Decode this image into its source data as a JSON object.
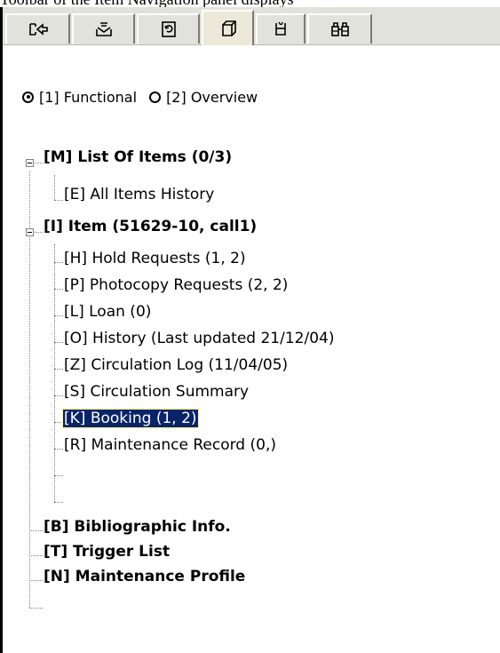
{
  "caption": "Toolbar of the Item Navigation panel displays",
  "toolbar": {
    "tabs": [
      {
        "icon": "pointer-arrow-icon",
        "active": false
      },
      {
        "icon": "inbox-tray-icon",
        "active": false
      },
      {
        "icon": "refresh-document-icon",
        "active": false
      },
      {
        "icon": "copy-window-icon",
        "active": true
      },
      {
        "icon": "broken-cup-icon",
        "active": false
      },
      {
        "icon": "binoculars-icon",
        "active": false
      }
    ]
  },
  "view_mode": {
    "options": [
      {
        "label": "[1] Functional",
        "checked": true
      },
      {
        "label": "[2] Overview",
        "checked": false
      }
    ]
  },
  "tree": {
    "items": [
      {
        "label": "[M] List Of Items (0/3)",
        "bold": true,
        "expanded": true
      },
      {
        "label": "[E] All Items History"
      },
      {
        "label": "[I] Item (51629-10, call1)",
        "bold": true,
        "expanded": true
      },
      {
        "label": "[H] Hold Requests (1, 2)"
      },
      {
        "label": "[P] Photocopy Requests (2, 2)"
      },
      {
        "label": "[L] Loan (0)"
      },
      {
        "label": "[O] History (Last updated 21/12/04)"
      },
      {
        "label": "[Z] Circulation Log (11/04/05)"
      },
      {
        "label": "[S] Circulation Summary"
      },
      {
        "label": "[K] Booking (1, 2)",
        "selected": true
      },
      {
        "label": "[R] Maintenance Record (0,)"
      },
      {
        "label": "[B] Bibliographic Info.",
        "bold": true
      },
      {
        "label": "[T] Trigger List",
        "bold": true
      },
      {
        "label": "[N] Maintenance Profile",
        "bold": true
      }
    ]
  },
  "colors": {
    "selection_bg": "#0a246a",
    "selection_fg": "#ffffff",
    "toolbar_bg": "#e2e2dd"
  }
}
